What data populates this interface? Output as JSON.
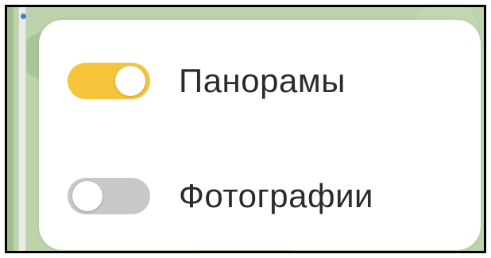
{
  "layers_panel": {
    "items": [
      {
        "label": "Панорамы",
        "enabled": true,
        "toggle_color": "#f6c43a"
      },
      {
        "label": "Фотографии",
        "enabled": false,
        "toggle_color": "#c8c8c8"
      }
    ]
  },
  "colors": {
    "toggle_on": "#f6c43a",
    "toggle_off": "#c8c8c8",
    "panel_bg": "#ffffff",
    "text": "#2b2b2b"
  }
}
